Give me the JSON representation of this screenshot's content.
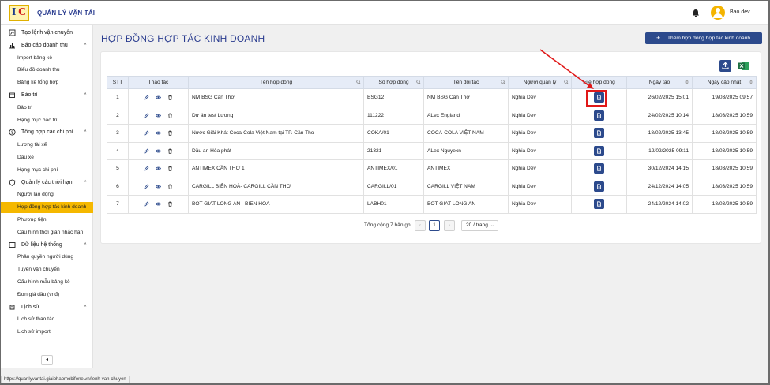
{
  "app": {
    "title": "QUẢN LÝ VẬN TẢI",
    "user": "Bao dev"
  },
  "sidebar": {
    "entries": [
      {
        "kind": "group",
        "label": "Tạo lệnh vận chuyển",
        "icon": "route-icon",
        "chev": ""
      },
      {
        "kind": "group",
        "label": "Báo cáo doanh thu",
        "icon": "bar-chart-icon",
        "chev": "^"
      },
      {
        "kind": "item",
        "label": "Import bảng kê"
      },
      {
        "kind": "item",
        "label": "Biểu đồ doanh thu"
      },
      {
        "kind": "item",
        "label": "Bảng kê tổng hợp"
      },
      {
        "kind": "group",
        "label": "Bảo trì",
        "icon": "wrench-icon",
        "chev": "^"
      },
      {
        "kind": "item",
        "label": "Bảo trì"
      },
      {
        "kind": "item",
        "label": "Hạng mục bảo trì"
      },
      {
        "kind": "group",
        "label": "Tổng hợp các chi phí",
        "icon": "dollar-icon",
        "chev": "^"
      },
      {
        "kind": "item",
        "label": "Lương tài xế"
      },
      {
        "kind": "item",
        "label": "Dầu xe"
      },
      {
        "kind": "item",
        "label": "Hạng mục chi phí"
      },
      {
        "kind": "group",
        "label": "Quản lý các thời hạn",
        "icon": "shield-icon",
        "chev": "^"
      },
      {
        "kind": "item",
        "label": "Người lao động"
      },
      {
        "kind": "item",
        "label": "Hợp đồng hợp tác kinh doanh",
        "active": true
      },
      {
        "kind": "item",
        "label": "Phương tiện"
      },
      {
        "kind": "item",
        "label": "Cấu hình thời gian nhắc hạn"
      },
      {
        "kind": "group",
        "label": "Dữ liệu hệ thống",
        "icon": "database-icon",
        "chev": "^"
      },
      {
        "kind": "item",
        "label": "Phân quyền người dùng"
      },
      {
        "kind": "item",
        "label": "Tuyến vận chuyển"
      },
      {
        "kind": "item",
        "label": "Cấu hình mẫu bảng kê"
      },
      {
        "kind": "item",
        "label": "Đơn giá dầu (vnđ)"
      },
      {
        "kind": "group",
        "label": "Lịch sử",
        "icon": "history-icon",
        "chev": "^"
      },
      {
        "kind": "item",
        "label": "Lịch sử thao tác"
      },
      {
        "kind": "item",
        "label": "Lịch sử import"
      }
    ],
    "collapse_label": "◂"
  },
  "page": {
    "title": "HỢP ĐỒNG HỢP TÁC KINH DOANH",
    "add_button": "Thêm hợp đồng hợp tác kinh doanh",
    "add_plus": "+"
  },
  "table": {
    "columns": [
      "STT",
      "Thao tác",
      "Tên hợp đồng",
      "Số hợp đồng",
      "Tên đối tác",
      "Người quản lý",
      "File hợp đồng",
      "Ngày tạo",
      "Ngày cập nhật"
    ],
    "rows": [
      {
        "stt": "1",
        "name": "NM BSG Cần Thơ",
        "number": "BSG12",
        "partner": "NM BSG Cần Thơ",
        "manager": "Nghia Dev",
        "created": "26/02/2025 15:01",
        "updated": "19/03/2025 09:57"
      },
      {
        "stt": "2",
        "name": "Dự án test Lương",
        "number": "111222",
        "partner": "ALex England",
        "manager": "Nghia Dev",
        "created": "24/02/2025 10:14",
        "updated": "18/03/2025 10:59"
      },
      {
        "stt": "3",
        "name": "Nước Giải Khát Coca-Cola Việt Nam tại TP. Cần Thơ",
        "number": "COKA/01",
        "partner": "COCA-COLA VIỆT NAM",
        "manager": "Nghia Dev",
        "created": "18/02/2025 13:45",
        "updated": "18/03/2025 10:59"
      },
      {
        "stt": "4",
        "name": "Dầu an Hòa phát",
        "number": "21321",
        "partner": "ALex Nguyexn",
        "manager": "Nghia Dev",
        "created": "12/02/2025 09:11",
        "updated": "18/03/2025 10:59"
      },
      {
        "stt": "5",
        "name": "ANTIMEX CẦN THƠ 1",
        "number": "ANTIMEX/01",
        "partner": "ANTIMEX",
        "manager": "Nghia Dev",
        "created": "30/12/2024 14:15",
        "updated": "18/03/2025 10:59"
      },
      {
        "stt": "6",
        "name": "CARGILL BIÊN HOÀ- CARGILL CẦN THƠ",
        "number": "CARGILL/01",
        "partner": "CARGILL VIỆT NAM",
        "manager": "Nghia Dev",
        "created": "24/12/2024 14:05",
        "updated": "18/03/2025 10:59"
      },
      {
        "stt": "7",
        "name": "BOT GIAT LONG AN - BIEN HOA",
        "number": "LABH01",
        "partner": "BOT GIAT LONG AN",
        "manager": "Nghia Dev",
        "created": "24/12/2024 14:02",
        "updated": "18/03/2025 10:59"
      }
    ]
  },
  "pagination": {
    "total": "Tổng cộng 7 bản ghi",
    "current": "1",
    "prev": "‹",
    "next": "›",
    "page_size": "20 / trang",
    "dropdown": "⌄"
  },
  "status_bar": {
    "url": "https://quanlyvantai.giaiphapmobifone.vn/lenh-van-chuyen"
  },
  "colors": {
    "primary": "#2c4a8c",
    "active": "#f5b800",
    "annotation": "#e01818"
  }
}
